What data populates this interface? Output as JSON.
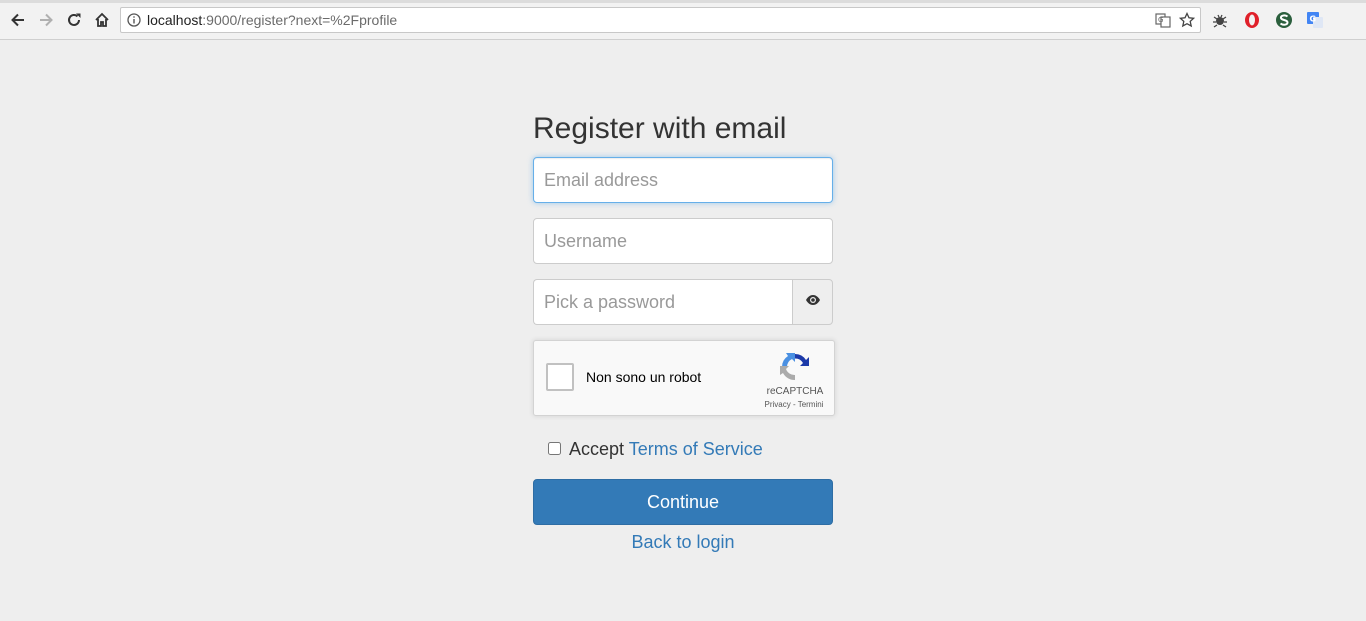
{
  "browser": {
    "url_host": "localhost",
    "url_rest": ":9000/register?next=%2Fprofile",
    "icons": [
      "back-arrow-icon",
      "forward-arrow-icon",
      "reload-icon",
      "home-icon",
      "info-icon",
      "translate-icon",
      "bookmark-star-icon",
      "extension-bug-icon",
      "opera-icon",
      "extension-s-icon",
      "google-translate-icon"
    ]
  },
  "form": {
    "title": "Register with email",
    "email_placeholder": "Email address",
    "username_placeholder": "Username",
    "password_placeholder": "Pick a password",
    "password_toggle_icon": "eye-icon",
    "captcha": {
      "label": "Non sono un robot",
      "brand": "reCAPTCHA",
      "links": "Privacy - Termini"
    },
    "terms": {
      "prefix": "Accept",
      "link": "Terms of Service"
    },
    "continue_label": "Continue",
    "back_link": "Back to login"
  },
  "colors": {
    "page_background": "#eeeeee",
    "primary": "#337ab7",
    "focus_border": "#66afe9",
    "text": "#333333"
  }
}
